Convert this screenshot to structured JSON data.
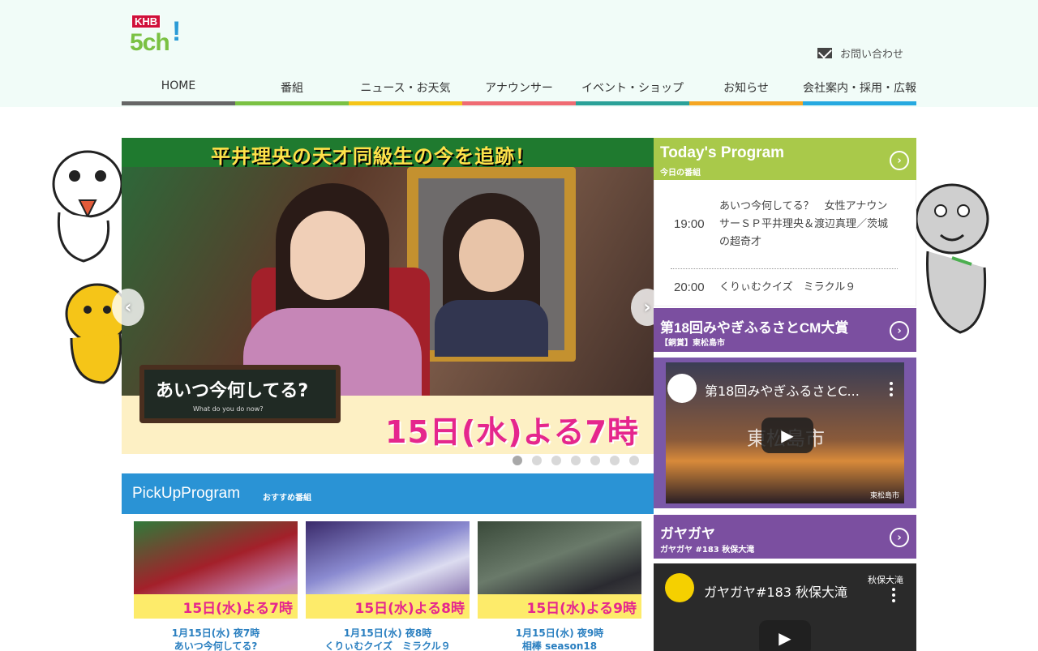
{
  "header": {
    "logo_text_top": "KHB",
    "logo_text_main": "5ch",
    "logo_bang": "!",
    "contact_label": "お問い合わせ"
  },
  "nav": {
    "items": [
      {
        "label": "HOME",
        "color": "#666666"
      },
      {
        "label": "番組",
        "color": "#7ac143"
      },
      {
        "label": "ニュース・お天気",
        "color": "#f5c518"
      },
      {
        "label": "アナウンサー",
        "color": "#ef6b73"
      },
      {
        "label": "イベント・ショップ",
        "color": "#2aa198"
      },
      {
        "label": "お知らせ",
        "color": "#f5a623"
      },
      {
        "label": "会社案内・採用・広報",
        "color": "#26a9e0"
      }
    ]
  },
  "hero": {
    "banner_text": "平井理央の天才同級生の今を追跡！",
    "chalk_title": "あいつ今何してる?",
    "chalk_sub": "What do you do now?",
    "date_text": "15日(水)よる7時",
    "prev_arrow": "‹",
    "next_arrow": "›",
    "slide_count": 7,
    "active_slide": 0
  },
  "pickup": {
    "title": "PickUpProgram",
    "subtitle": "おすすめ番組",
    "cards": [
      {
        "date": "1月15日(水) 夜7時",
        "name": "あいつ今何してる?",
        "stripe": "15日(水)よる7時"
      },
      {
        "date": "1月15日(水) 夜8時",
        "name": "くりぃむクイズ　ミラクル９",
        "stripe": "15日(水)よる8時"
      },
      {
        "date": "1月15日(水) 夜9時",
        "name": "相棒 season18",
        "stripe": "15日(水)よる9時"
      }
    ]
  },
  "today": {
    "title": "Today's Program",
    "subtitle": "今日の番組",
    "go": "›",
    "programs": [
      {
        "time": "19:00",
        "name": "あいつ今何してる？　女性アナウンサーＳＰ平井理央＆渡辺真理／茨城の超奇才"
      },
      {
        "time": "20:00",
        "name": "くりぃむクイズ　ミラクル９"
      }
    ]
  },
  "cm_award": {
    "title": "第18回みやぎふるさとCM大賞",
    "subtitle": "【銅賞】東松島市",
    "go": "›",
    "video_title": "第18回みやぎふるさとC...",
    "overlay_text": "東松島市",
    "corner_text": "東松島市"
  },
  "gayagaya": {
    "title": "ガヤガヤ",
    "subtitle": "ガヤガヤ #183 秋保大滝",
    "go": "›",
    "video_title": "ガヤガヤ#183 秋保大滝",
    "location_text": "秋保大滝"
  },
  "colors": {
    "header_bg": "#f1fcf8",
    "pickup_blue": "#2a93d5",
    "today_green": "#a9c94a",
    "purple": "#7b4fa0",
    "accent_pink": "#e5268d"
  }
}
